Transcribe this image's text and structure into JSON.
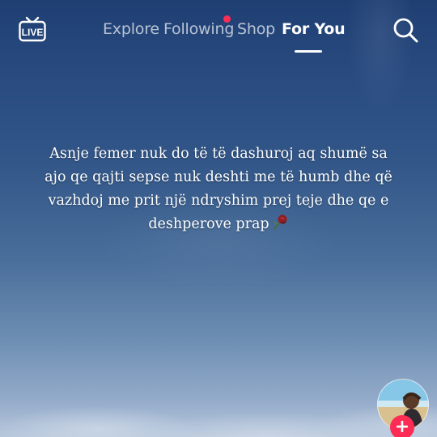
{
  "top_bar": {
    "live_label": "LIVE",
    "tabs": [
      {
        "label": "Explore",
        "active": false
      },
      {
        "label": "Following",
        "active": false,
        "has_notification": true
      },
      {
        "label": "Shop",
        "active": false
      },
      {
        "label": "For You",
        "active": true
      }
    ],
    "search_icon": "search-icon",
    "live_icon": "live-tv-icon"
  },
  "post": {
    "caption": "Asnje femer nuk do të të dashuroj aq shumë sa ajo qe qajti sepse nuk deshti me të humb dhe që vazhdoj me prit një ndryshim prej teje dhe qe e deshperove prap",
    "caption_emoji": "wilted-rose-icon"
  },
  "creator": {
    "avatar_icon": "avatar",
    "follow_icon": "plus-icon",
    "follow_label": "+"
  },
  "colors": {
    "accent": "#fe2c55",
    "text": "#ffffff",
    "sky_top": "#1f3f73",
    "sky_bottom": "#b7c7db"
  }
}
